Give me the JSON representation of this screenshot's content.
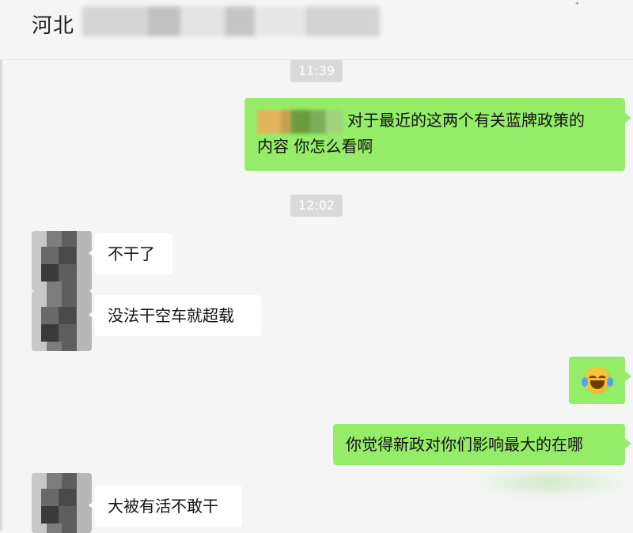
{
  "header": {
    "title": "河北",
    "more_glyph": "ᐩ"
  },
  "messages": [
    {
      "kind": "time",
      "text": "11:39"
    },
    {
      "kind": "text",
      "side": "right",
      "text": "对于最近的这两个有关蓝牌政策的内容 你怎么看啊",
      "line1": "对于最近的这两个有关蓝牌政策的",
      "line2": "内容 你怎么看啊"
    },
    {
      "kind": "time",
      "text": "12:02"
    },
    {
      "kind": "text",
      "side": "left",
      "text": "不干了"
    },
    {
      "kind": "text",
      "side": "left",
      "text": "没法干空车就超载"
    },
    {
      "kind": "emoji",
      "side": "right",
      "emoji": "crying-laughing"
    },
    {
      "kind": "text",
      "side": "right",
      "text": "你觉得新政对你们影响最大的在哪"
    },
    {
      "kind": "text",
      "side": "left",
      "text": "大被有活不敢干"
    }
  ],
  "colors": {
    "background": "#f5f5f5",
    "outgoing_bubble": "#95ec69",
    "incoming_bubble": "#ffffff",
    "timestamp_bg": "#dadada"
  }
}
